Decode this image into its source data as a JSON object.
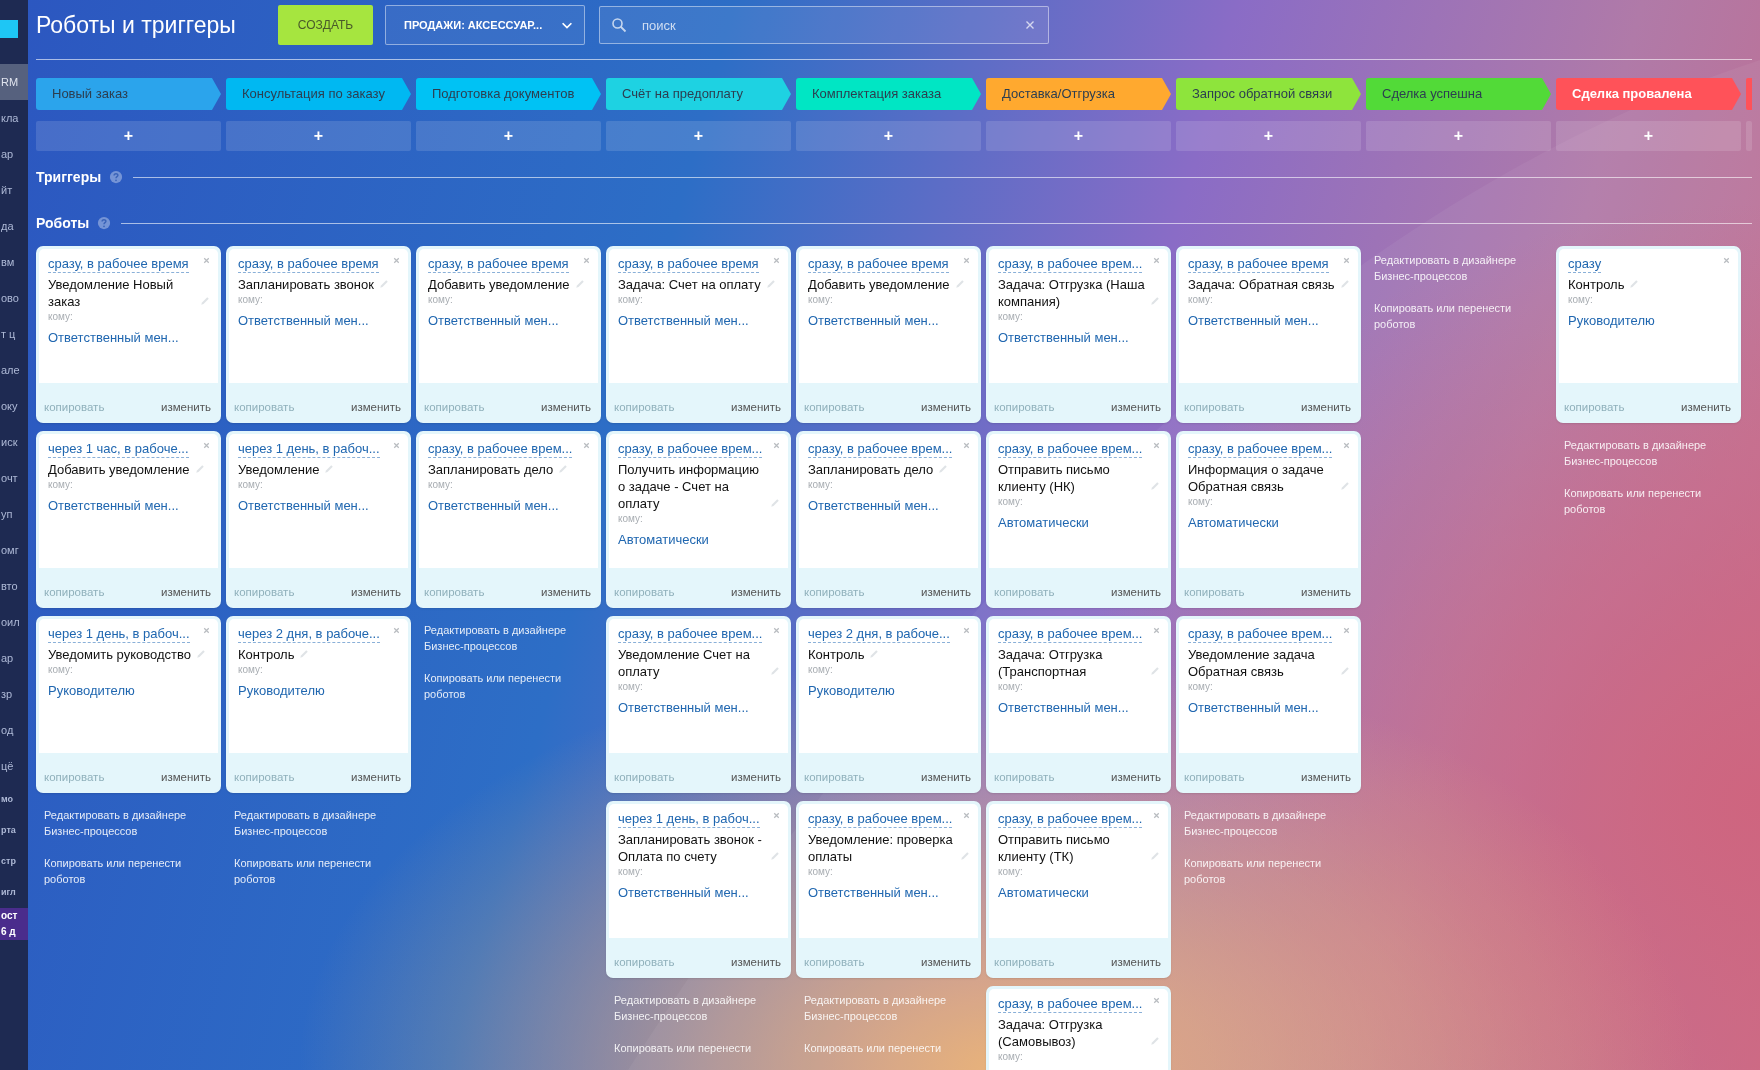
{
  "sidebar": {
    "items": [
      {
        "label": "RM",
        "kind": "item",
        "selected": true
      },
      {
        "label": "кла",
        "kind": "item",
        "selected": false
      },
      {
        "label": "ар",
        "kind": "item",
        "selected": false
      },
      {
        "label": "йт",
        "kind": "item",
        "selected": false
      },
      {
        "label": "да",
        "kind": "item",
        "selected": false
      },
      {
        "label": "вм",
        "kind": "item",
        "selected": false
      },
      {
        "label": "ово",
        "kind": "item",
        "selected": false
      },
      {
        "label": "т ц",
        "kind": "item",
        "selected": false
      },
      {
        "label": "але",
        "kind": "item",
        "selected": false
      },
      {
        "label": "оку",
        "kind": "item",
        "selected": false
      },
      {
        "label": "иск",
        "kind": "item",
        "selected": false
      },
      {
        "label": "очт",
        "kind": "item",
        "selected": false
      },
      {
        "label": "уп",
        "kind": "item",
        "selected": false
      },
      {
        "label": "омг",
        "kind": "item",
        "selected": false
      },
      {
        "label": "вто",
        "kind": "item",
        "selected": false
      },
      {
        "label": "оил",
        "kind": "item",
        "selected": false
      },
      {
        "label": "ар",
        "kind": "item",
        "selected": false
      },
      {
        "label": "зр",
        "kind": "item",
        "selected": false
      },
      {
        "label": "од",
        "kind": "item",
        "selected": false
      },
      {
        "label": "цё",
        "kind": "item",
        "selected": false
      },
      {
        "label": "мо",
        "kind": "small",
        "selected": false
      },
      {
        "label": "рта",
        "kind": "small",
        "selected": false
      },
      {
        "label": "стр",
        "kind": "small",
        "selected": false
      },
      {
        "label": "игл",
        "kind": "small",
        "selected": false
      },
      {
        "label": "ост",
        "kind": "badge",
        "selected": false
      },
      {
        "label": "6 д",
        "kind": "badge",
        "selected": false
      }
    ]
  },
  "header": {
    "title": "Роботы и триггеры",
    "create_button": "СОЗДАТЬ",
    "pipeline": "ПРОДАЖИ: АКСЕССУАР...",
    "search": {
      "placeholder": "поиск"
    }
  },
  "add_label": "+",
  "sections": [
    {
      "title": "Триггеры"
    },
    {
      "title": "Роботы"
    }
  ],
  "columns": [
    {
      "stage": "Новый заказ",
      "color": "#2ba4ec",
      "kind": "progress",
      "robots": [
        {
          "delay": "сразу, в рабочее время",
          "title": "Уведомление Новый заказ",
          "recipient_label": "кому:",
          "recipient": "Ответственный мен...",
          "copy": "копировать",
          "copy_disabled": true,
          "edit": "изменить"
        },
        {
          "delay": "через 1 час, в рабоче...",
          "title": "Добавить уведомление",
          "recipient_label": "кому:",
          "recipient": "Ответственный мен...",
          "copy": "копировать",
          "copy_disabled": true,
          "edit": "изменить"
        },
        {
          "delay": "через 1 день, в рабоч...",
          "title": "Уведомить руководство",
          "recipient_label": "кому:",
          "recipient": "Руководителю",
          "copy": "копировать",
          "copy_disabled": true,
          "edit": "изменить"
        }
      ],
      "links": [
        "Редактировать в дизайнере Бизнес-процессов",
        "Копировать или перенести роботов"
      ]
    },
    {
      "stage": "Консультация по заказу",
      "color": "#00b8f2",
      "kind": "progress",
      "robots": [
        {
          "delay": "сразу, в рабочее время",
          "title": "Запланировать звонок",
          "recipient_label": "кому:",
          "recipient": "Ответственный мен...",
          "copy": "копировать",
          "copy_disabled": true,
          "edit": "изменить"
        },
        {
          "delay": "через 1 день, в рабоч...",
          "title": "Уведомление",
          "recipient_label": "кому:",
          "recipient": "Ответственный мен...",
          "copy": "копировать",
          "copy_disabled": true,
          "edit": "изменить"
        },
        {
          "delay": "через 2 дня, в рабоче...",
          "title": "Контроль",
          "recipient_label": "кому:",
          "recipient": "Руководителю",
          "copy": "копировать",
          "copy_disabled": true,
          "edit": "изменить"
        }
      ],
      "links": [
        "Редактировать в дизайнере Бизнес-процессов",
        "Копировать или перенести роботов"
      ]
    },
    {
      "stage": "Подготовка документов",
      "color": "#00c2f4",
      "kind": "progress",
      "robots": [
        {
          "delay": "сразу, в рабочее время",
          "title": "Добавить уведомление",
          "recipient_label": "кому:",
          "recipient": "Ответственный мен...",
          "copy": "копировать",
          "copy_disabled": true,
          "edit": "изменить"
        },
        {
          "delay": "сразу, в рабочее врем...",
          "title": "Запланировать дело",
          "recipient_label": "кому:",
          "recipient": "Ответственный мен...",
          "copy": "копировать",
          "copy_disabled": true,
          "edit": "изменить"
        }
      ],
      "links": [
        "Редактировать в дизайнере Бизнес-процессов",
        "Копировать или перенести роботов"
      ]
    },
    {
      "stage": "Счёт на предоплату",
      "color": "#1ed2e2",
      "kind": "progress",
      "robots": [
        {
          "delay": "сразу, в рабочее время",
          "title": "Задача: Счет на оплату",
          "recipient_label": "кому:",
          "recipient": "Ответственный мен...",
          "copy": "копировать",
          "copy_disabled": true,
          "edit": "изменить"
        },
        {
          "delay": "сразу, в рабочее врем...",
          "title": "Получить информацию о задаче - Счет на оплату",
          "recipient_label": "кому:",
          "recipient": "Автоматически",
          "copy": "копировать",
          "copy_disabled": true,
          "edit": "изменить"
        },
        {
          "delay": "сразу, в рабочее врем...",
          "title": "Уведомление Счет на оплату",
          "recipient_label": "кому:",
          "recipient": "Ответственный мен...",
          "copy": "копировать",
          "copy_disabled": true,
          "edit": "изменить"
        },
        {
          "delay": "через 1 день, в рабоч...",
          "title": "Запланировать звонок - Оплата по счету",
          "recipient_label": "кому:",
          "recipient": "Ответственный мен...",
          "copy": "копировать",
          "copy_disabled": true,
          "edit": "изменить"
        }
      ],
      "links": [
        "Редактировать в дизайнере Бизнес-процессов",
        "Копировать или перенести"
      ]
    },
    {
      "stage": "Комплектация заказа",
      "color": "#00e6c4",
      "kind": "progress",
      "robots": [
        {
          "delay": "сразу, в рабочее время",
          "title": "Добавить уведомление",
          "recipient_label": "кому:",
          "recipient": "Ответственный мен...",
          "copy": "копировать",
          "copy_disabled": true,
          "edit": "изменить"
        },
        {
          "delay": "сразу, в рабочее врем...",
          "title": "Запланировать дело",
          "recipient_label": "кому:",
          "recipient": "Ответственный мен...",
          "copy": "копировать",
          "copy_disabled": true,
          "edit": "изменить"
        },
        {
          "delay": "через 2 дня, в рабоче...",
          "title": "Контроль",
          "recipient_label": "кому:",
          "recipient": "Руководителю",
          "copy": "копировать",
          "copy_disabled": true,
          "edit": "изменить"
        },
        {
          "delay": "сразу, в рабочее врем...",
          "title": "Уведомление: проверка оплаты",
          "recipient_label": "кому:",
          "recipient": "Ответственный мен...",
          "copy": "копировать",
          "copy_disabled": true,
          "edit": "изменить"
        }
      ],
      "links": [
        "Редактировать в дизайнере Бизнес-процессов",
        "Копировать или перенести"
      ]
    },
    {
      "stage": "Доставка/Отгрузка",
      "color": "#ffa92f",
      "kind": "progress",
      "robots": [
        {
          "delay": "сразу, в рабочее врем...",
          "title": "Задача: Отгрузка (Наша компания)",
          "recipient_label": "кому:",
          "recipient": "Ответственный мен...",
          "copy": "копировать",
          "copy_disabled": true,
          "edit": "изменить"
        },
        {
          "delay": "сразу, в рабочее врем...",
          "title": "Отправить письмо клиенту (НК)",
          "recipient_label": "кому:",
          "recipient": "Автоматически",
          "copy": "копировать",
          "copy_disabled": true,
          "edit": "изменить"
        },
        {
          "delay": "сразу, в рабочее врем...",
          "title": "Задача: Отгрузка (Транспортная",
          "recipient_label": "кому:",
          "recipient": "Ответственный мен...",
          "copy": "копировать",
          "copy_disabled": true,
          "edit": "изменить"
        },
        {
          "delay": "сразу, в рабочее врем...",
          "title": "Отправить письмо клиенту (ТК)",
          "recipient_label": "кому:",
          "recipient": "Автоматически",
          "copy": "копировать",
          "copy_disabled": true,
          "edit": "изменить"
        },
        {
          "delay": "сразу, в рабочее врем...",
          "title": "Задача: Отгрузка (Самовывоз)",
          "recipient_label": "кому:"
        }
      ]
    },
    {
      "stage": "Запрос обратной связи",
      "color": "#8ee43c",
      "kind": "progress",
      "robots": [
        {
          "delay": "сразу, в рабочее время",
          "title": "Задача: Обратная связь",
          "recipient_label": "кому:",
          "recipient": "Ответственный мен...",
          "copy": "копировать",
          "copy_disabled": true,
          "edit": "изменить"
        },
        {
          "delay": "сразу, в рабочее врем...",
          "title": "Информация о задаче Обратная связь",
          "recipient_label": "кому:",
          "recipient": "Автоматически",
          "copy": "копировать",
          "copy_disabled": true,
          "edit": "изменить"
        },
        {
          "delay": "сразу, в рабочее врем...",
          "title": "Уведомление задача Обратная связь",
          "recipient_label": "кому:",
          "recipient": "Ответственный мен...",
          "copy": "копировать",
          "copy_disabled": true,
          "edit": "изменить"
        }
      ],
      "links": [
        "Редактировать в дизайнере Бизнес-процессов",
        "Копировать или перенести роботов"
      ]
    },
    {
      "stage": "Сделка успешна",
      "color": "#52da38",
      "kind": "progress",
      "links": [
        "Редактировать в дизайнере Бизнес-процессов",
        "Копировать или перенести роботов"
      ]
    },
    {
      "stage": "Сделка провалена",
      "color": "#ff5259",
      "kind": "failure",
      "robots": [
        {
          "delay": "сразу",
          "title": "Контроль",
          "recipient_label": "кому:",
          "recipient": "Руководителю",
          "copy": "копировать",
          "copy_disabled": true,
          "edit": "изменить"
        }
      ],
      "links": [
        "Редактировать в дизайнере Бизнес-процессов",
        "Копировать или перенести роботов"
      ]
    }
  ]
}
